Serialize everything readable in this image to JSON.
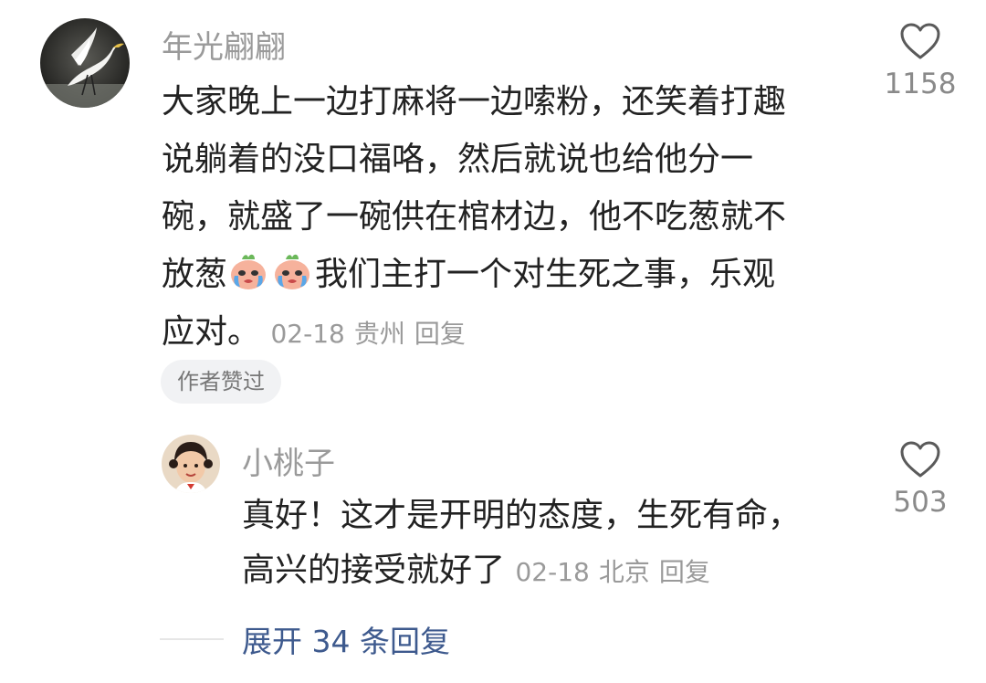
{
  "comment": {
    "username": "年光翩翩",
    "lines_before_emoji": [
      "大家晚上一边打麻将一边嗦粉，还笑着打趣",
      "说躺着的没口福咯，然后就说也给他分一",
      "碗，就盛了一碗供在棺材边，他不吃葱就不"
    ],
    "line4_lead": "放葱",
    "line4_rest": "我们主打一个对生死之事，乐观",
    "line5": "应对。",
    "date": "02-18",
    "location": "贵州",
    "reply_label": "回复",
    "like_count": "1158",
    "author_badge": "作者赞过",
    "emoji_icon": "crying-face-icon",
    "heart_icon": "heart-outline-icon"
  },
  "reply": {
    "username": "小桃子",
    "line1": "真好！这才是开明的态度，生死有命，",
    "line2": "高兴的接受就好了",
    "date": "02-18",
    "location": "北京",
    "reply_label": "回复",
    "like_count": "503"
  },
  "expand": {
    "label": "展开 34 条回复"
  },
  "colors": {
    "text": "#222222",
    "muted": "#9a9a9a",
    "link": "#3e5a8e",
    "badge_bg": "#f1f2f4"
  }
}
